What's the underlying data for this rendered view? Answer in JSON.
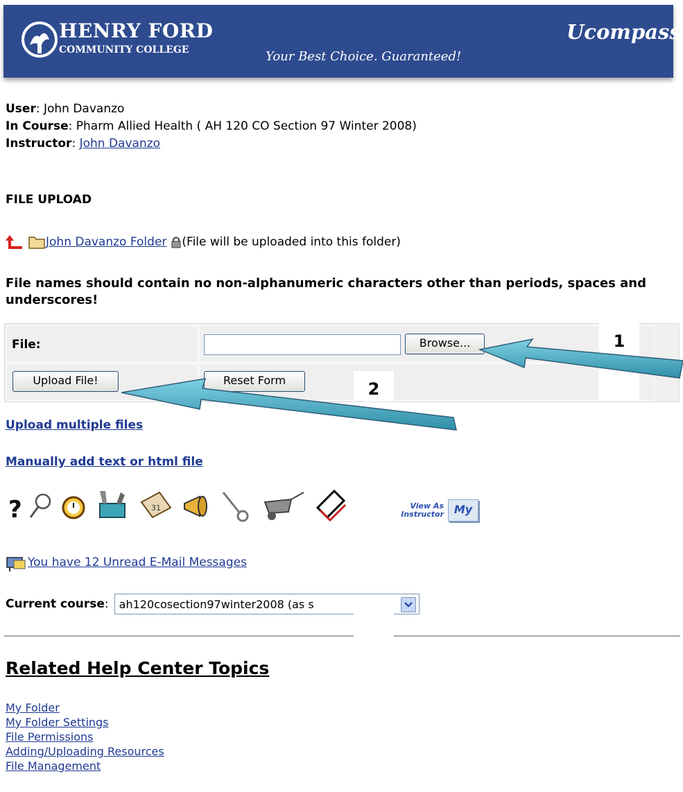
{
  "banner": {
    "brand_line1": "HENRY FORD",
    "brand_line2": "COMMUNITY COLLEGE",
    "slogan": "Your Best Choice. Guaranteed!",
    "product": "Ucompass",
    "color": "#2e4b8f"
  },
  "user_info": {
    "user_label": "User",
    "user_value": ": John Davanzo",
    "course_label": "In Course",
    "course_value": ": Pharm Allied Health ( AH 120 CO Section 97 Winter 2008)",
    "instructor_label": "Instructor",
    "instructor_sep": ": ",
    "instructor_link": "John Davanzo"
  },
  "page_title": "FILE UPLOAD",
  "folder": {
    "link": "John Davanzo Folder",
    "note": " (File will be uploaded into this folder)"
  },
  "warning": "File names should contain no non-alphanumeric characters other than periods, spaces and underscores!",
  "form": {
    "file_label": "File:",
    "file_value": "",
    "browse_label": "Browse...",
    "upload_label": "Upload File!",
    "reset_label": "Reset Form"
  },
  "links": {
    "upload_multiple": "Upload multiple files",
    "manual_add": "Manually add text or html file"
  },
  "toolbar_icons": [
    "help-icon",
    "search-icon",
    "stopwatch-icon",
    "toolbox-icon",
    "calendar-icon",
    "megaphone-icon",
    "key-icon",
    "wheelbarrow-icon",
    "book-icon",
    "view-as-instructor-icon",
    "my-icon"
  ],
  "view_as": {
    "line1": "View As",
    "line2": "Instructor",
    "my": "My"
  },
  "mail": {
    "text": "You have 12 Unread E-Mail Messages"
  },
  "course_select": {
    "label": "Current course",
    "sep": ": ",
    "selected": "ah120cosection97winter2008 (as s",
    "selected_tail": ")"
  },
  "help": {
    "heading": "Related Help Center Topics",
    "items": [
      "My Folder",
      "My Folder Settings",
      "File Permissions",
      "Adding/Uploading Resources",
      "File Management"
    ]
  },
  "callouts": {
    "one": "1",
    "two": "2"
  }
}
